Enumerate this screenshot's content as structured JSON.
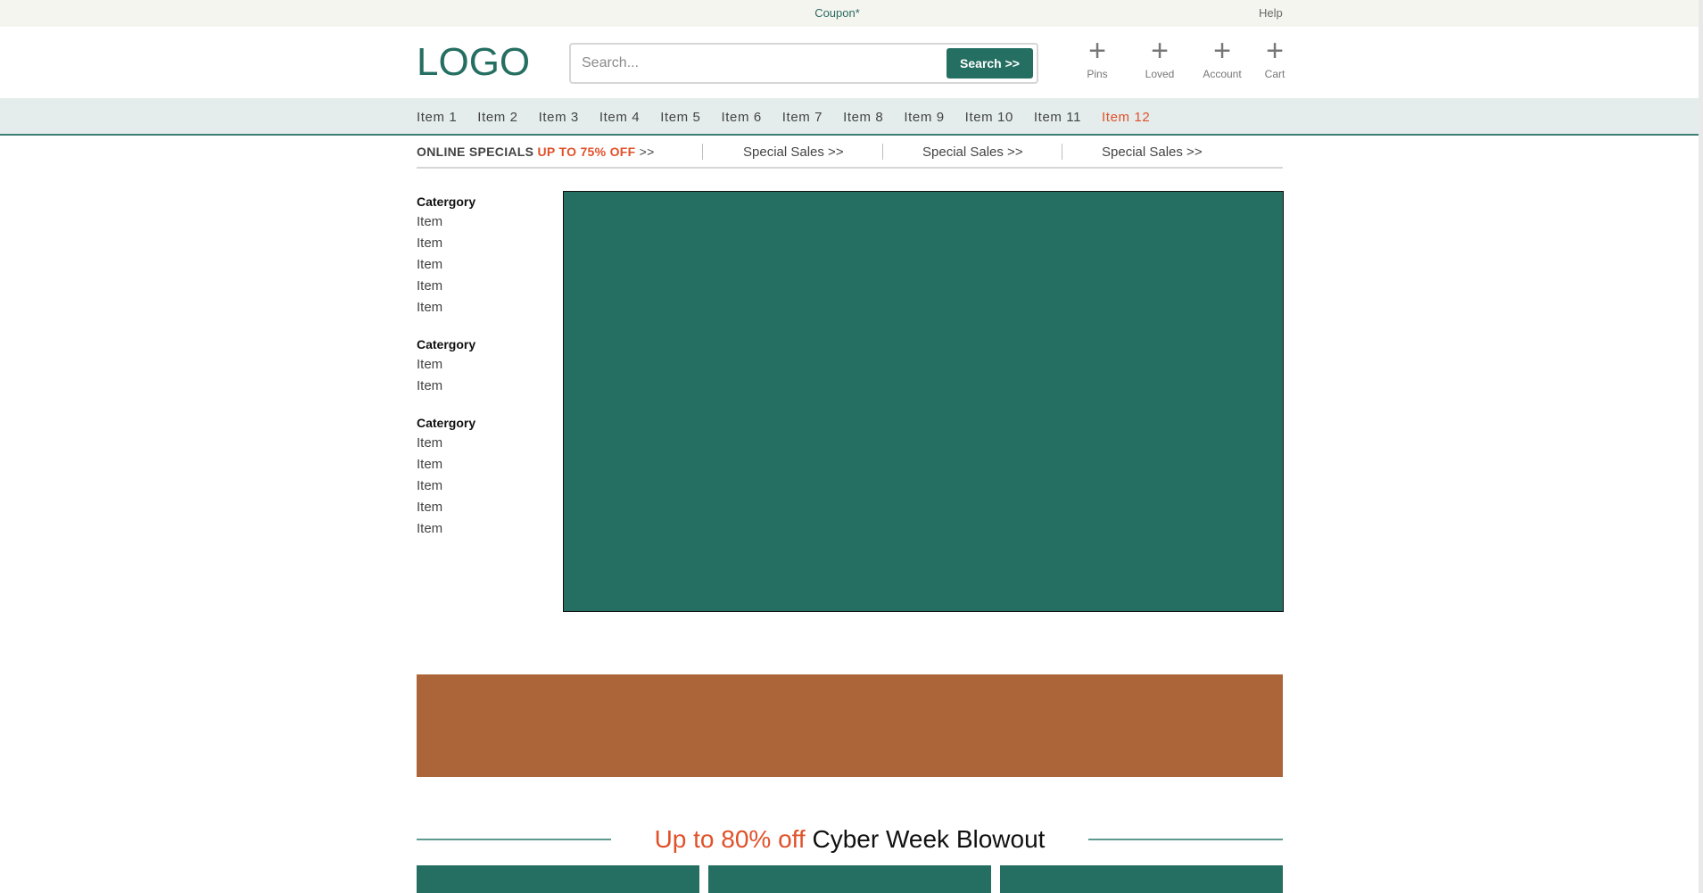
{
  "topbar": {
    "coupon": "Coupon*",
    "help": "Help"
  },
  "header": {
    "logo": "LOGO",
    "search_placeholder": "Search...",
    "search_button": "Search >>",
    "icons": [
      {
        "label": "Pins",
        "icon": "plus-icon"
      },
      {
        "label": "Loved",
        "icon": "plus-icon"
      },
      {
        "label": "Account",
        "icon": "plus-icon"
      },
      {
        "label": "Cart",
        "icon": "plus-icon"
      }
    ]
  },
  "nav": {
    "items": [
      "Item 1",
      "Item 2",
      "Item 3",
      "Item 4",
      "Item 5",
      "Item 6",
      "Item 7",
      "Item 8",
      "Item 9",
      "Item 10",
      "Item 11",
      "Item 12"
    ],
    "active_index": 11
  },
  "specials": {
    "lead_text": "ONLINE SPECIALS",
    "lead_highlight": "UP TO 75% OFF",
    "lead_arrow": ">>",
    "links": [
      "Special Sales >>",
      "Special Sales >>",
      "Special Sales >>"
    ]
  },
  "sidebar": {
    "groups": [
      {
        "title": "Catergory",
        "items": [
          "Item",
          "Item",
          "Item",
          "Item",
          "Item"
        ]
      },
      {
        "title": "Catergory",
        "items": [
          "Item",
          "Item"
        ]
      },
      {
        "title": "Catergory",
        "items": [
          "Item",
          "Item",
          "Item",
          "Item",
          "Item"
        ]
      }
    ]
  },
  "section_heading": {
    "highlight": "Up to 80% off",
    "text": "Cyber Week Blowout"
  },
  "colors": {
    "brand_green": "#256f62",
    "accent_orange": "#e0512a",
    "promo_brown": "#ab6539",
    "nav_bg": "#e4ecec",
    "topbar_bg": "#f5f5f0"
  }
}
